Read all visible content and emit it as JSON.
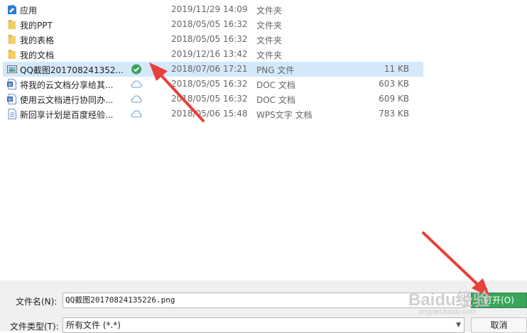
{
  "files": [
    {
      "name": "应用",
      "date": "2019/11/29 14:09",
      "type": "文件夹",
      "size": "",
      "icon": "special-folder-icon",
      "sync": ""
    },
    {
      "name": "我的PPT",
      "date": "2018/05/05 16:32",
      "type": "文件夹",
      "size": "",
      "icon": "folder-icon",
      "sync": ""
    },
    {
      "name": "我的表格",
      "date": "2018/05/05 16:32",
      "type": "文件夹",
      "size": "",
      "icon": "folder-icon",
      "sync": ""
    },
    {
      "name": "我的文档",
      "date": "2019/12/16 13:42",
      "type": "文件夹",
      "size": "",
      "icon": "folder-icon",
      "sync": ""
    },
    {
      "name": "QQ截图201708241352...",
      "date": "2018/07/06 17:21",
      "type": "PNG 文件",
      "size": "11 KB",
      "icon": "image-file-icon",
      "sync": "synced-check-icon",
      "selected": true
    },
    {
      "name": "将我的云文档分享给其...",
      "date": "2018/05/05 16:32",
      "type": "DOC 文档",
      "size": "603 KB",
      "icon": "doc-file-icon",
      "sync": "cloud-icon"
    },
    {
      "name": "使用云文档进行协同办...",
      "date": "2018/05/05 16:32",
      "type": "DOC 文档",
      "size": "609 KB",
      "icon": "doc-file-icon",
      "sync": "cloud-icon"
    },
    {
      "name": "新回享计划是百度经验...",
      "date": "2018/05/06 15:48",
      "type": "WPS文字 文档",
      "size": "783 KB",
      "icon": "wps-file-icon",
      "sync": "cloud-icon"
    }
  ],
  "bottom": {
    "filename_label": "文件名(N):",
    "filename_value": "QQ截图20170824135226.png",
    "filetype_label": "文件类型(T):",
    "filetype_value": "所有文件 (*.*)",
    "open_label": "打开(O)",
    "cancel_label": "取消"
  },
  "watermark": {
    "text": "Baidu经验",
    "sub": "jingyan.baidu.com"
  },
  "colors": {
    "selected_row": "#d4e8fa",
    "open_button": "#3aa45a",
    "annotation_arrow": "#e8403a",
    "folder": "#f2c94c"
  }
}
